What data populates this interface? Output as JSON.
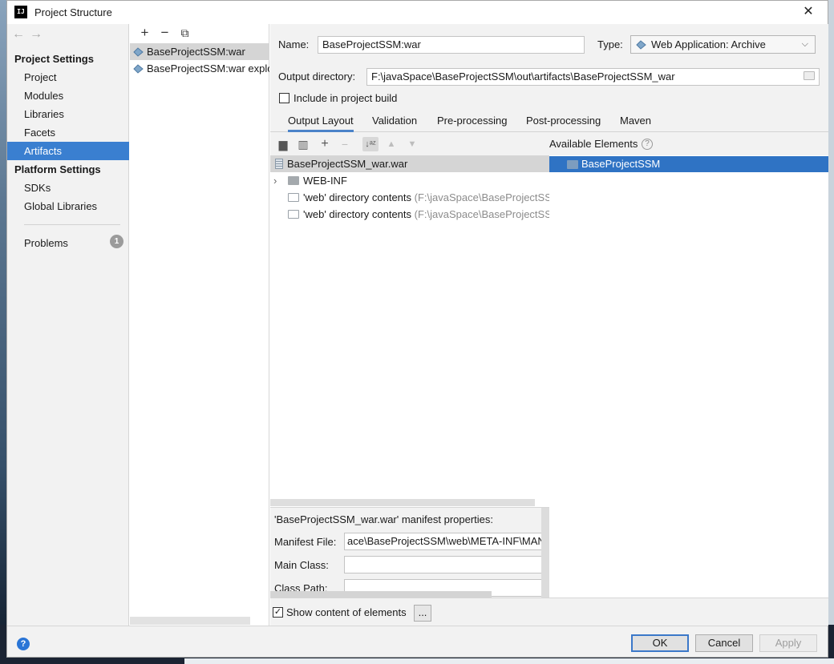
{
  "window": {
    "title": "Project Structure",
    "logo_text": "IJ"
  },
  "nav": {
    "project_settings_header": "Project Settings",
    "project_items": [
      "Project",
      "Modules",
      "Libraries",
      "Facets",
      "Artifacts"
    ],
    "selected": "Artifacts",
    "platform_settings_header": "Platform Settings",
    "platform_items": [
      "SDKs",
      "Global Libraries"
    ],
    "problems_label": "Problems",
    "problems_count": "1"
  },
  "artifacts": {
    "toolbar": [
      "+",
      "−",
      "⧉"
    ],
    "items": [
      "BaseProjectSSM:war",
      "BaseProjectSSM:war exploded"
    ]
  },
  "form": {
    "name_label": "Name:",
    "name_value": "BaseProjectSSM:war",
    "type_label": "Type:",
    "type_value": "Web Application: Archive",
    "output_label": "Output directory:",
    "output_value": "F:\\javaSpace\\BaseProjectSSM\\out\\artifacts\\BaseProjectSSM_war",
    "include_build_label": "Include in project build",
    "include_build_checked": false
  },
  "tabs": [
    "Output Layout",
    "Validation",
    "Pre-processing",
    "Post-processing",
    "Maven"
  ],
  "layout_tree": {
    "root": "BaseProjectSSM_war.war",
    "webinf": "WEB-INF",
    "rows": [
      {
        "label": "'web' directory contents",
        "hint": " (F:\\javaSpace\\BaseProjectSSM\\web)"
      },
      {
        "label": "'web' directory contents",
        "hint": " (F:\\javaSpace\\BaseProjectSSM\\web)"
      }
    ]
  },
  "available": {
    "header": "Available Elements",
    "items": [
      "BaseProjectSSM"
    ]
  },
  "manifest": {
    "header": "'BaseProjectSSM_war.war' manifest properties:",
    "file_label": "Manifest File:",
    "file_value": "ace\\BaseProjectSSM\\web\\META-INF\\MANIFEST.MF",
    "main_class_label": "Main Class:",
    "main_class_value": "",
    "class_path_label": "Class Path:",
    "class_path_value": ""
  },
  "show_content": {
    "label": "Show content of elements",
    "checked": true,
    "dots": "..."
  },
  "footer": {
    "help": "?",
    "ok": "OK",
    "cancel": "Cancel",
    "apply": "Apply"
  }
}
